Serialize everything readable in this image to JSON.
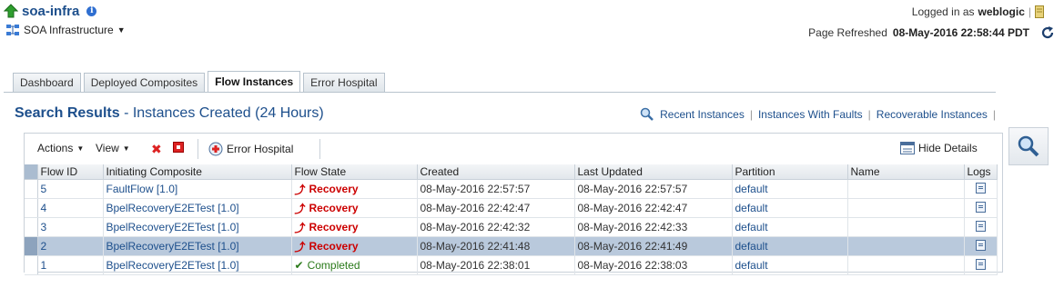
{
  "header": {
    "title": "soa-infra",
    "subtitle": "SOA Infrastructure",
    "logged_in_prefix": "Logged in as",
    "user": "weblogic",
    "refreshed_prefix": "Page Refreshed",
    "refreshed_time": "08-May-2016 22:58:44 PDT"
  },
  "tabs": [
    {
      "label": "Dashboard"
    },
    {
      "label": "Deployed Composites"
    },
    {
      "label": "Flow Instances"
    },
    {
      "label": "Error Hospital"
    }
  ],
  "results": {
    "title": "Search Results",
    "subtitle": "- Instances Created (24 Hours)",
    "links": [
      "Recent Instances",
      "Instances With Faults",
      "Recoverable Instances"
    ]
  },
  "toolbar": {
    "actions": "Actions",
    "view": "View",
    "error_hospital": "Error Hospital",
    "hide_details": "Hide Details"
  },
  "table": {
    "columns": [
      "Flow ID",
      "Initiating Composite",
      "Flow State",
      "Created",
      "Last Updated",
      "Partition",
      "Name",
      "Logs"
    ],
    "rows": [
      {
        "id": "5",
        "composite": "FaultFlow [1.0]",
        "state": "Recovery",
        "created": "08-May-2016 22:57:57",
        "updated": "08-May-2016 22:57:57",
        "partition": "default",
        "name": ""
      },
      {
        "id": "4",
        "composite": "BpelRecoveryE2ETest [1.0]",
        "state": "Recovery",
        "created": "08-May-2016 22:42:47",
        "updated": "08-May-2016 22:42:47",
        "partition": "default",
        "name": ""
      },
      {
        "id": "3",
        "composite": "BpelRecoveryE2ETest [1.0]",
        "state": "Recovery",
        "created": "08-May-2016 22:42:32",
        "updated": "08-May-2016 22:42:33",
        "partition": "default",
        "name": ""
      },
      {
        "id": "2",
        "composite": "BpelRecoveryE2ETest [1.0]",
        "state": "Recovery",
        "created": "08-May-2016 22:41:48",
        "updated": "08-May-2016 22:41:49",
        "partition": "default",
        "name": ""
      },
      {
        "id": "1",
        "composite": "BpelRecoveryE2ETest [1.0]",
        "state": "Completed",
        "created": "08-May-2016 22:38:01",
        "updated": "08-May-2016 22:38:03",
        "partition": "default",
        "name": ""
      }
    ]
  },
  "colors": {
    "link": "#1d4f8c",
    "recovery": "#cc0000",
    "completed": "#2a7a1a",
    "selected_row": "#b9c9dc"
  }
}
